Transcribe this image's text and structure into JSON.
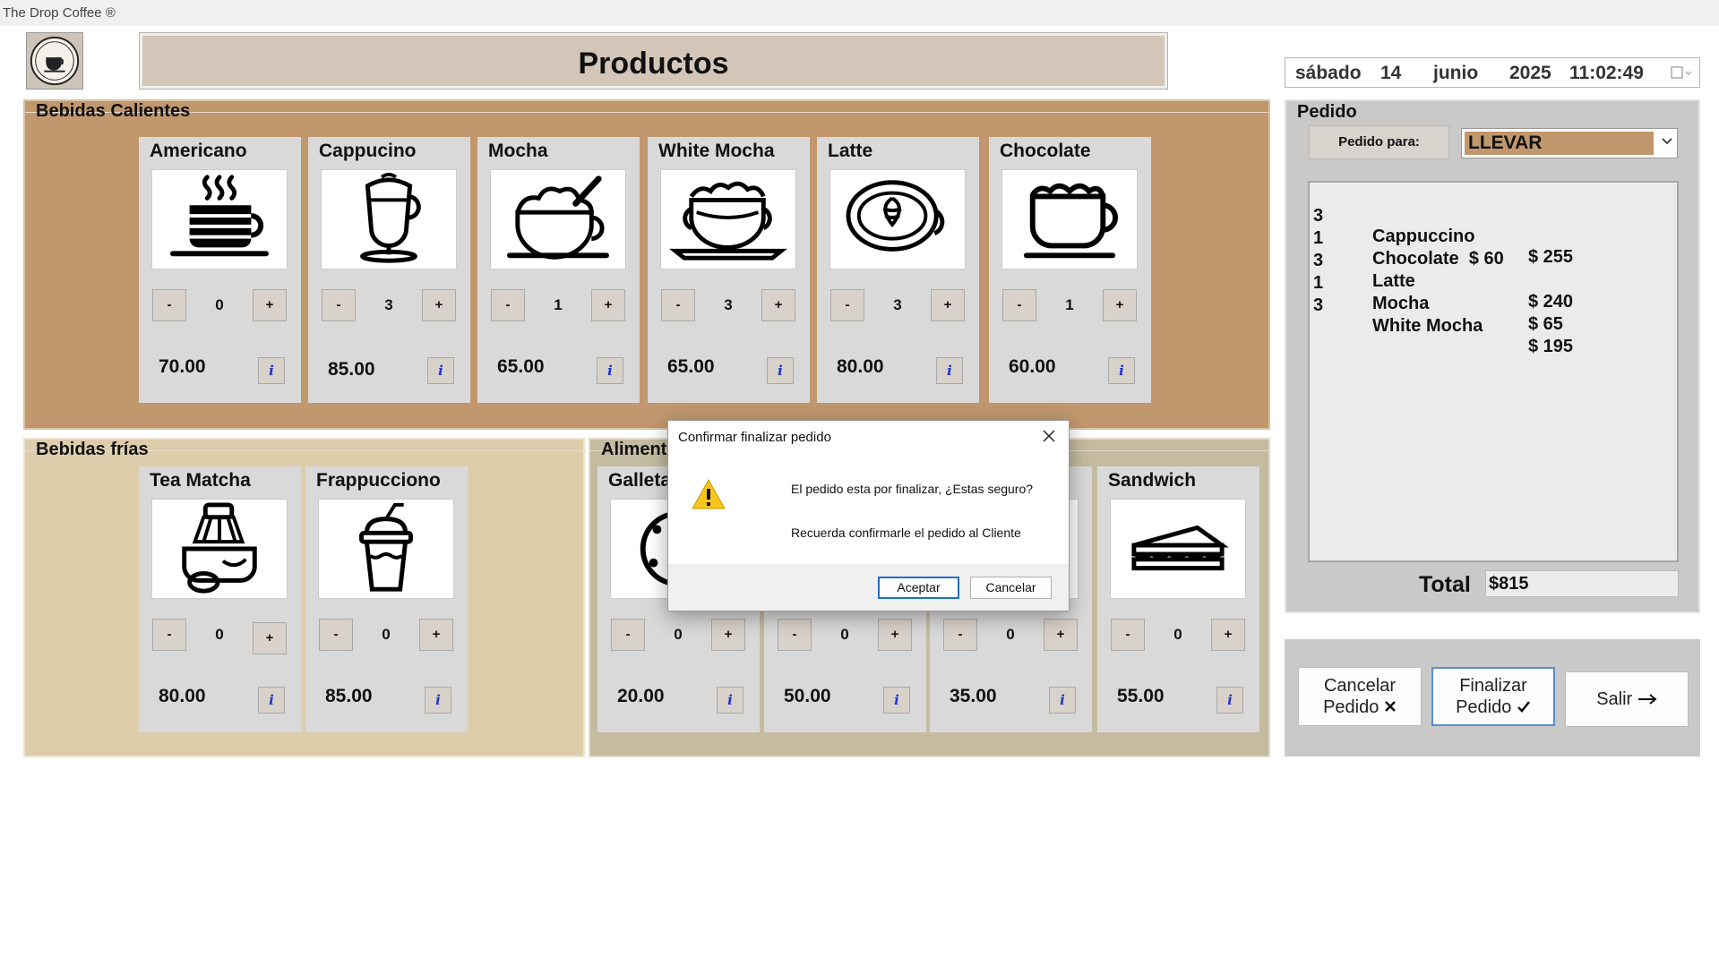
{
  "window": {
    "title": "The Drop Coffee ®"
  },
  "header": {
    "title": "Productos"
  },
  "datetime": {
    "weekday": "sábado",
    "day": "14",
    "month": "junio",
    "year": "2025",
    "time": "11:02:49"
  },
  "sections": {
    "hot": {
      "title": "Bebidas Calientes"
    },
    "cold": {
      "title": "Bebidas frías"
    },
    "food": {
      "title": "Aliment"
    }
  },
  "products": {
    "americano": {
      "name": "Americano",
      "qty": "0",
      "price": "70.00",
      "icon": "coffee-cup-steam-icon"
    },
    "cappucino": {
      "name": "Cappucino",
      "qty": "3",
      "price": "85.00",
      "icon": "cappuccino-glass-icon"
    },
    "mocha": {
      "name": "Mocha",
      "qty": "1",
      "price": "65.00",
      "icon": "mocha-cup-icon"
    },
    "white_mocha": {
      "name": "White Mocha",
      "qty": "3",
      "price": "65.00",
      "icon": "white-mocha-cup-icon"
    },
    "latte": {
      "name": "Latte",
      "qty": "3",
      "price": "80.00",
      "icon": "latte-art-cup-icon"
    },
    "chocolate": {
      "name": "Chocolate",
      "qty": "1",
      "price": "60.00",
      "icon": "chocolate-cup-icon"
    },
    "tea_matcha": {
      "name": "Tea Matcha",
      "qty": "0",
      "price": "80.00",
      "icon": "matcha-whisk-icon"
    },
    "frappucciono": {
      "name": "Frappucciono",
      "qty": "0",
      "price": "85.00",
      "icon": "frappe-cup-icon"
    },
    "galleta": {
      "name": "Galleta",
      "qty": "0",
      "price": "20.00",
      "icon": "cookie-icon"
    },
    "food2": {
      "name": "",
      "qty": "0",
      "price": "50.00",
      "icon": "food-icon"
    },
    "food3": {
      "name": "",
      "qty": "0",
      "price": "35.00",
      "icon": "food-icon"
    },
    "sandwich": {
      "name": "Sandwich",
      "qty": "0",
      "price": "55.00",
      "icon": "sandwich-icon"
    }
  },
  "buttons": {
    "minus": "-",
    "plus": "+",
    "info": "i"
  },
  "pedido": {
    "title": "Pedido",
    "para_label": "Pedido para:",
    "para_value": "LLEVAR",
    "items": [
      {
        "qty": "3",
        "name": "Cappuccino",
        "price": "$ 255"
      },
      {
        "qty": "1",
        "name": "Chocolate  $ 60",
        "price": ""
      },
      {
        "qty": "3",
        "name": "Latte",
        "price": "$ 240"
      },
      {
        "qty": "1",
        "name": "Mocha",
        "price": "$ 65"
      },
      {
        "qty": "3",
        "name": "White Mocha",
        "price": "$ 195"
      }
    ],
    "total_label": "Total",
    "total_value": "$815"
  },
  "actions": {
    "cancel_line1": "Cancelar",
    "cancel_line2": "Pedido",
    "finish_line1": "Finalizar",
    "finish_line2": "Pedido",
    "exit": "Salir"
  },
  "dialog": {
    "title": "Confirmar finalizar pedido",
    "message1": "El pedido esta por finalizar, ¿Estas seguro?",
    "message2": "Recuerda confirmarle el pedido al Cliente",
    "accept": "Aceptar",
    "cancel": "Cancelar"
  },
  "colors": {
    "hot_bg": "#c1976d",
    "cold_bg": "#ddcdab",
    "food_bg": "#c4bba0",
    "card_bg": "#d9d9d9",
    "accent": "#1c6fd1"
  }
}
